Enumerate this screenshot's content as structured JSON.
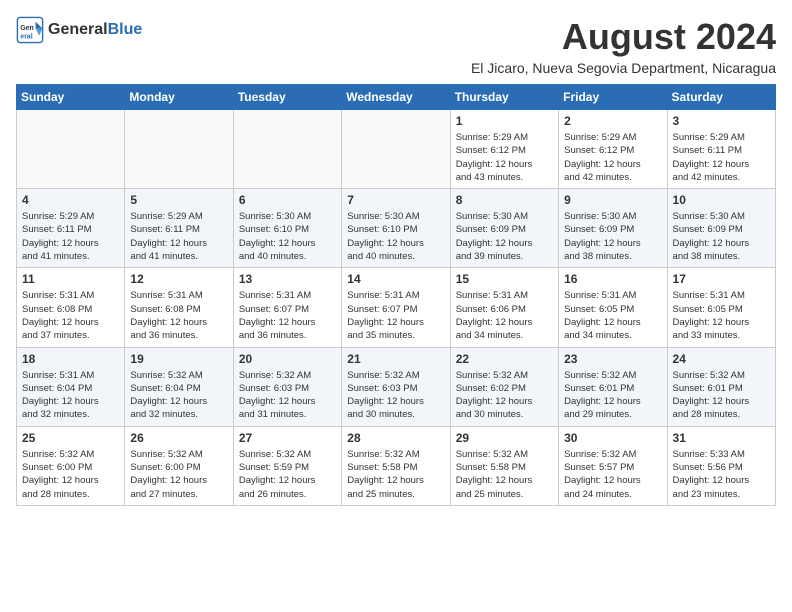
{
  "logo": {
    "text_general": "General",
    "text_blue": "Blue"
  },
  "title": {
    "month_year": "August 2024",
    "location": "El Jicaro, Nueva Segovia Department, Nicaragua"
  },
  "weekdays": [
    "Sunday",
    "Monday",
    "Tuesday",
    "Wednesday",
    "Thursday",
    "Friday",
    "Saturday"
  ],
  "weeks": [
    [
      {
        "day": "",
        "info": ""
      },
      {
        "day": "",
        "info": ""
      },
      {
        "day": "",
        "info": ""
      },
      {
        "day": "",
        "info": ""
      },
      {
        "day": "1",
        "info": "Sunrise: 5:29 AM\nSunset: 6:12 PM\nDaylight: 12 hours\nand 43 minutes."
      },
      {
        "day": "2",
        "info": "Sunrise: 5:29 AM\nSunset: 6:12 PM\nDaylight: 12 hours\nand 42 minutes."
      },
      {
        "day": "3",
        "info": "Sunrise: 5:29 AM\nSunset: 6:11 PM\nDaylight: 12 hours\nand 42 minutes."
      }
    ],
    [
      {
        "day": "4",
        "info": "Sunrise: 5:29 AM\nSunset: 6:11 PM\nDaylight: 12 hours\nand 41 minutes."
      },
      {
        "day": "5",
        "info": "Sunrise: 5:29 AM\nSunset: 6:11 PM\nDaylight: 12 hours\nand 41 minutes."
      },
      {
        "day": "6",
        "info": "Sunrise: 5:30 AM\nSunset: 6:10 PM\nDaylight: 12 hours\nand 40 minutes."
      },
      {
        "day": "7",
        "info": "Sunrise: 5:30 AM\nSunset: 6:10 PM\nDaylight: 12 hours\nand 40 minutes."
      },
      {
        "day": "8",
        "info": "Sunrise: 5:30 AM\nSunset: 6:09 PM\nDaylight: 12 hours\nand 39 minutes."
      },
      {
        "day": "9",
        "info": "Sunrise: 5:30 AM\nSunset: 6:09 PM\nDaylight: 12 hours\nand 38 minutes."
      },
      {
        "day": "10",
        "info": "Sunrise: 5:30 AM\nSunset: 6:09 PM\nDaylight: 12 hours\nand 38 minutes."
      }
    ],
    [
      {
        "day": "11",
        "info": "Sunrise: 5:31 AM\nSunset: 6:08 PM\nDaylight: 12 hours\nand 37 minutes."
      },
      {
        "day": "12",
        "info": "Sunrise: 5:31 AM\nSunset: 6:08 PM\nDaylight: 12 hours\nand 36 minutes."
      },
      {
        "day": "13",
        "info": "Sunrise: 5:31 AM\nSunset: 6:07 PM\nDaylight: 12 hours\nand 36 minutes."
      },
      {
        "day": "14",
        "info": "Sunrise: 5:31 AM\nSunset: 6:07 PM\nDaylight: 12 hours\nand 35 minutes."
      },
      {
        "day": "15",
        "info": "Sunrise: 5:31 AM\nSunset: 6:06 PM\nDaylight: 12 hours\nand 34 minutes."
      },
      {
        "day": "16",
        "info": "Sunrise: 5:31 AM\nSunset: 6:05 PM\nDaylight: 12 hours\nand 34 minutes."
      },
      {
        "day": "17",
        "info": "Sunrise: 5:31 AM\nSunset: 6:05 PM\nDaylight: 12 hours\nand 33 minutes."
      }
    ],
    [
      {
        "day": "18",
        "info": "Sunrise: 5:31 AM\nSunset: 6:04 PM\nDaylight: 12 hours\nand 32 minutes."
      },
      {
        "day": "19",
        "info": "Sunrise: 5:32 AM\nSunset: 6:04 PM\nDaylight: 12 hours\nand 32 minutes."
      },
      {
        "day": "20",
        "info": "Sunrise: 5:32 AM\nSunset: 6:03 PM\nDaylight: 12 hours\nand 31 minutes."
      },
      {
        "day": "21",
        "info": "Sunrise: 5:32 AM\nSunset: 6:03 PM\nDaylight: 12 hours\nand 30 minutes."
      },
      {
        "day": "22",
        "info": "Sunrise: 5:32 AM\nSunset: 6:02 PM\nDaylight: 12 hours\nand 30 minutes."
      },
      {
        "day": "23",
        "info": "Sunrise: 5:32 AM\nSunset: 6:01 PM\nDaylight: 12 hours\nand 29 minutes."
      },
      {
        "day": "24",
        "info": "Sunrise: 5:32 AM\nSunset: 6:01 PM\nDaylight: 12 hours\nand 28 minutes."
      }
    ],
    [
      {
        "day": "25",
        "info": "Sunrise: 5:32 AM\nSunset: 6:00 PM\nDaylight: 12 hours\nand 28 minutes."
      },
      {
        "day": "26",
        "info": "Sunrise: 5:32 AM\nSunset: 6:00 PM\nDaylight: 12 hours\nand 27 minutes."
      },
      {
        "day": "27",
        "info": "Sunrise: 5:32 AM\nSunset: 5:59 PM\nDaylight: 12 hours\nand 26 minutes."
      },
      {
        "day": "28",
        "info": "Sunrise: 5:32 AM\nSunset: 5:58 PM\nDaylight: 12 hours\nand 25 minutes."
      },
      {
        "day": "29",
        "info": "Sunrise: 5:32 AM\nSunset: 5:58 PM\nDaylight: 12 hours\nand 25 minutes."
      },
      {
        "day": "30",
        "info": "Sunrise: 5:32 AM\nSunset: 5:57 PM\nDaylight: 12 hours\nand 24 minutes."
      },
      {
        "day": "31",
        "info": "Sunrise: 5:33 AM\nSunset: 5:56 PM\nDaylight: 12 hours\nand 23 minutes."
      }
    ]
  ]
}
